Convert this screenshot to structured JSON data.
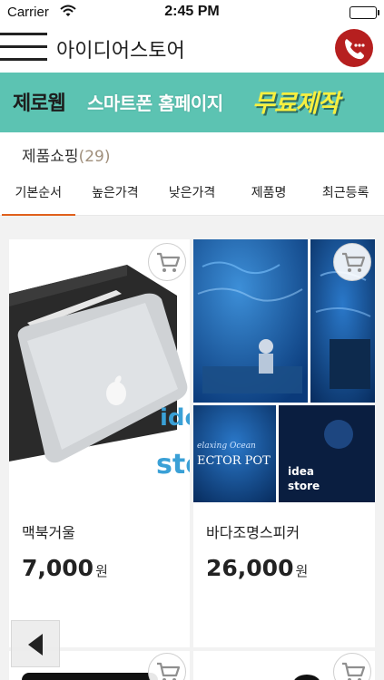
{
  "status_bar": {
    "carrier": "Carrier",
    "time": "2:45 PM",
    "battery_level": 1.0
  },
  "header": {
    "title": "아이디어스토어",
    "menu_icon": "hamburger-menu-icon",
    "call_icon": "phone-icon"
  },
  "banner": {
    "brand": "제로웹",
    "text": "스마트폰 홈페이지",
    "highlight": "무료제작"
  },
  "product_count": {
    "label": "제품쇼핑",
    "count": "(29)"
  },
  "tabs": [
    {
      "label": "기본순서",
      "active": true
    },
    {
      "label": "높은가격",
      "active": false
    },
    {
      "label": "낮은가격",
      "active": false
    },
    {
      "label": "제품명",
      "active": false
    },
    {
      "label": "최근등록",
      "active": false
    }
  ],
  "products": [
    {
      "name": "맥북거울",
      "price": "7,000",
      "currency": "원",
      "image_caption": [
        "ide",
        "sto"
      ]
    },
    {
      "name": "바다조명스피커",
      "price": "26,000",
      "currency": "원",
      "image_caption": [
        "elaxing Ocean",
        "ECTOR POT",
        "idea",
        "store"
      ]
    }
  ],
  "colors": {
    "accent": "#e0601c",
    "banner_bg": "#5cc3b2",
    "call_button": "#b61f1f",
    "count_number": "#a08f7c",
    "highlight_text": "#f7ef3f"
  }
}
